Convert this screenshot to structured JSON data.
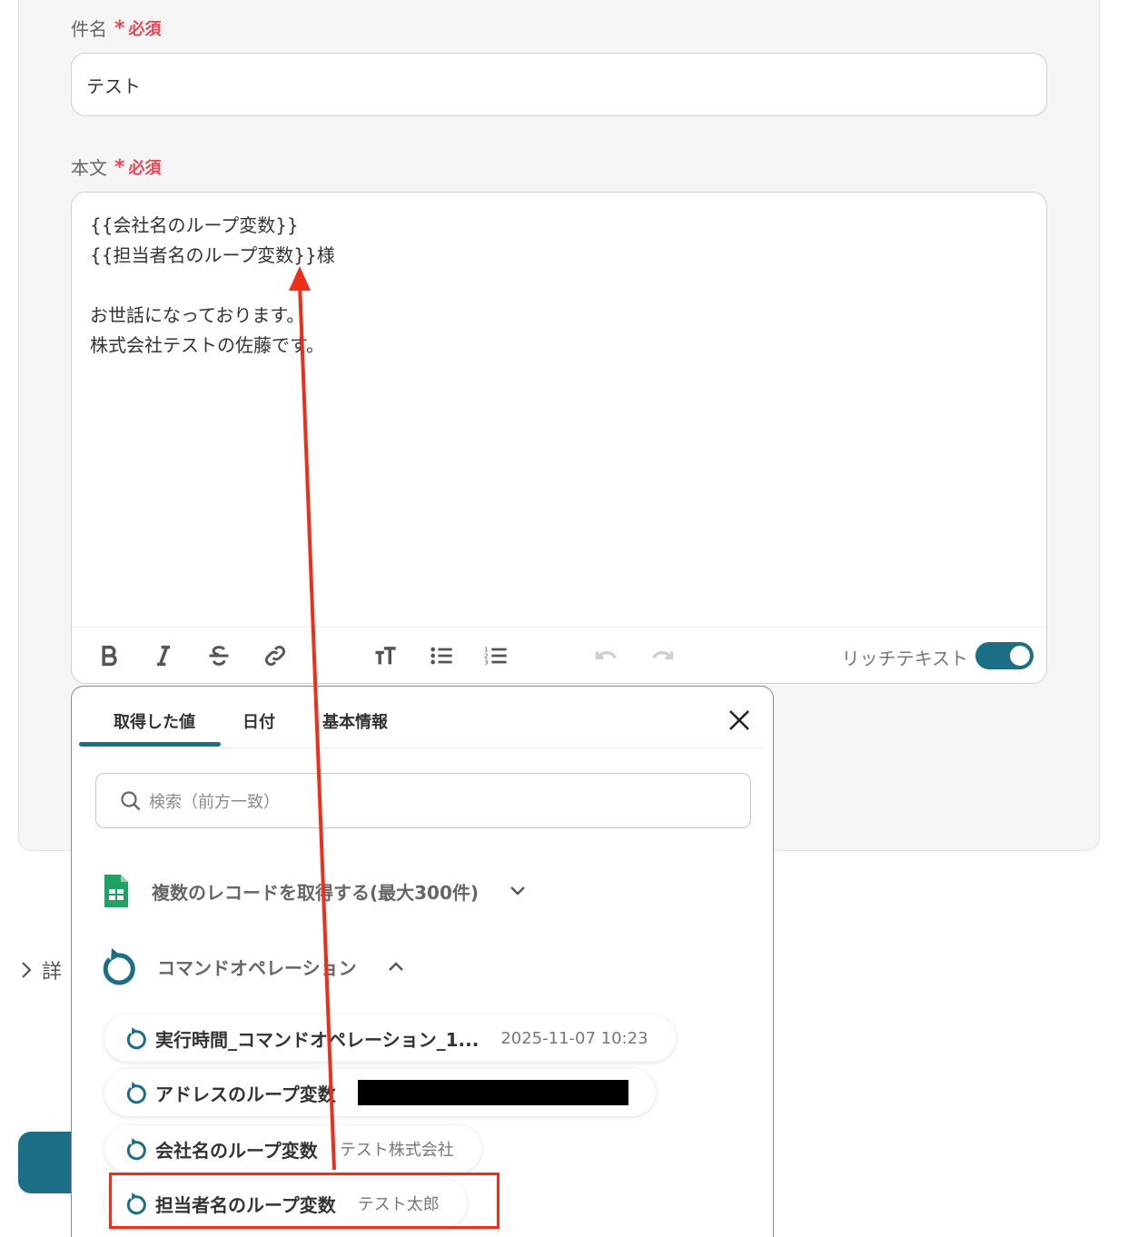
{
  "subject": {
    "label": "件名",
    "required": "必須",
    "value": "テスト"
  },
  "body": {
    "label": "本文",
    "required": "必須",
    "value": "{{会社名のループ変数}}\n{{担当者名のループ変数}}様\n\nお世話になっております。\n株式会社テストの佐藤です。"
  },
  "toolbar": {
    "rich_text_label": "リッチテキスト",
    "rich_text_on": true,
    "icons": [
      "bold-icon",
      "italic-icon",
      "strikethrough-icon",
      "link-icon",
      "text-size-icon",
      "bullet-list-icon",
      "numbered-list-icon",
      "undo-icon",
      "redo-icon"
    ]
  },
  "details": {
    "label": "詳"
  },
  "popup": {
    "tabs": [
      {
        "label": "取得した値",
        "active": true
      },
      {
        "label": "日付"
      },
      {
        "label": "基本情報"
      }
    ],
    "search": {
      "placeholder": "検索（前方一致）"
    },
    "groups": [
      {
        "label": "複数のレコードを取得する(最大300件)",
        "expanded": false,
        "icon": "sheets-icon"
      },
      {
        "label": "コマンドオペレーション",
        "expanded": true,
        "icon": "loop-icon"
      }
    ],
    "items": [
      {
        "name": "実行時間_コマンドオペレーション_1...",
        "value": "2025-11-07 10:23"
      },
      {
        "name": "アドレスのループ変数",
        "value": ""
      },
      {
        "name": "会社名のループ変数",
        "value": "テスト株式会社"
      },
      {
        "name": "担当者名のループ変数",
        "value": "テスト太郎"
      }
    ]
  },
  "colors": {
    "accent": "#1c6e87",
    "required": "#e5485a",
    "annotation": "#ee2e1a"
  }
}
